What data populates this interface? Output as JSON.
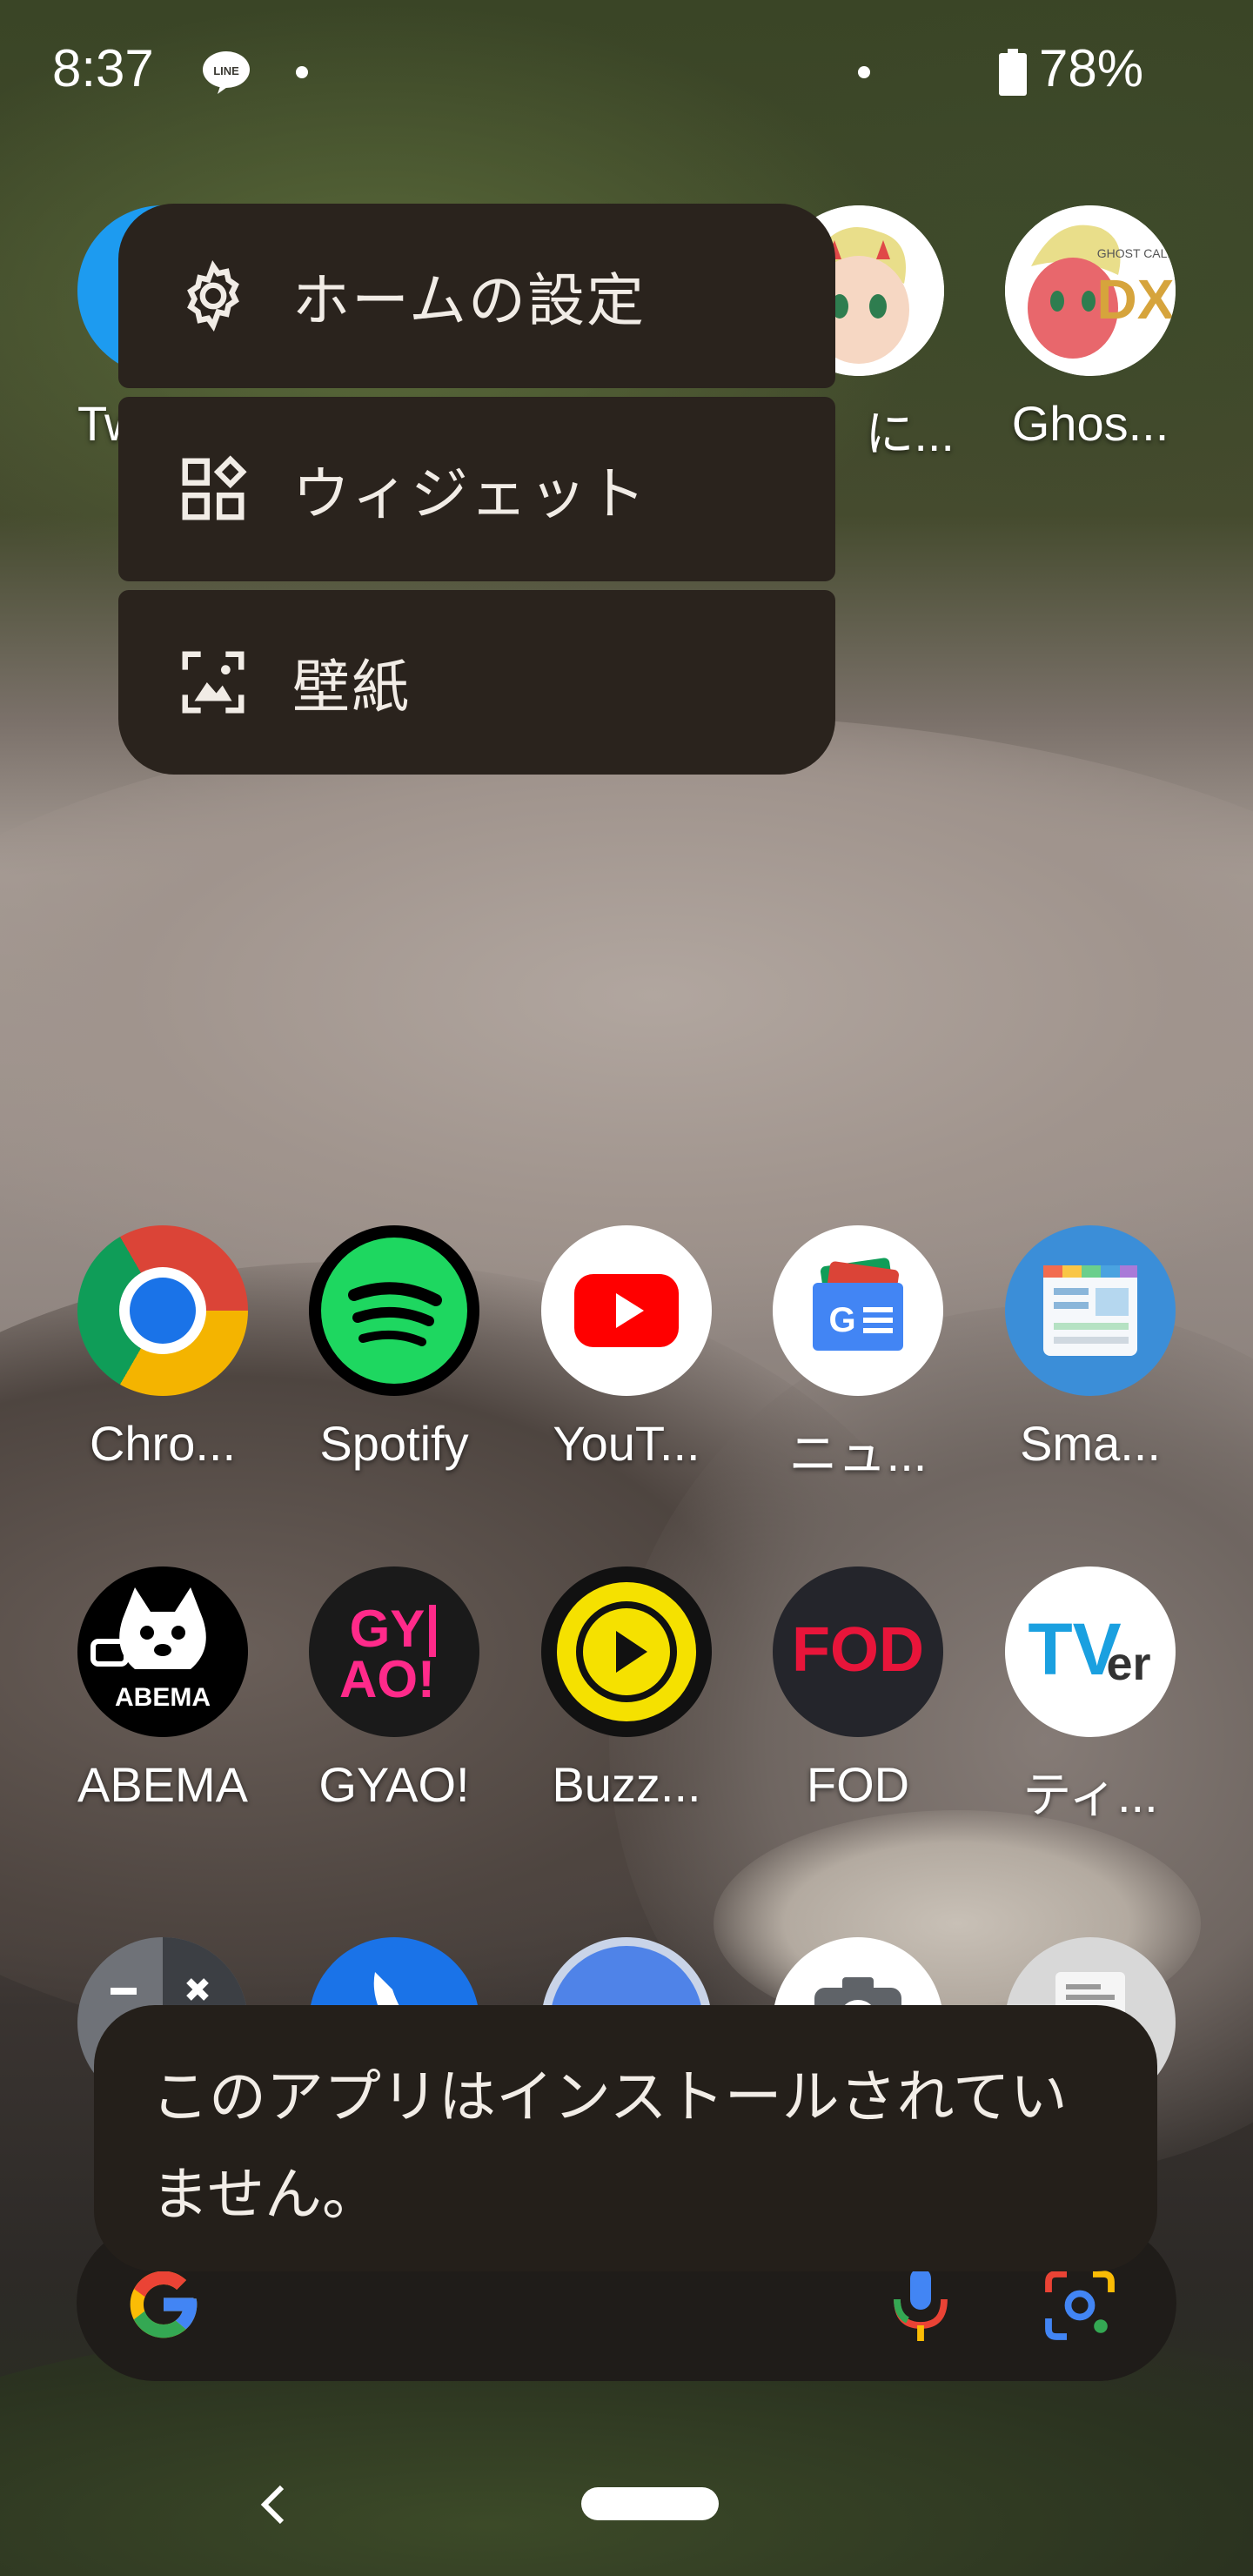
{
  "status_bar": {
    "time": "8:37",
    "notification_icon": "line-icon",
    "battery": "78%"
  },
  "context_menu": {
    "items": [
      {
        "label": "ホームの設定",
        "icon": "gear-icon"
      },
      {
        "label": "ウィジェット",
        "icon": "widgets-icon"
      },
      {
        "label": "壁紙",
        "icon": "wallpaper-icon"
      }
    ]
  },
  "top_row": {
    "apps": [
      {
        "label": "Tw",
        "icon": "twitter-icon"
      },
      {
        "label": "に...",
        "icon": "anime-character-icon"
      },
      {
        "label": "Ghos...",
        "icon": "ghost-call-dx-icon",
        "logo_text": "GHOST CALL DX"
      }
    ]
  },
  "app_grid": {
    "row1": [
      {
        "label": "Chro...",
        "icon": "chrome-icon"
      },
      {
        "label": "Spotify",
        "icon": "spotify-icon"
      },
      {
        "label": "YouT...",
        "icon": "youtube-icon"
      },
      {
        "label": "ニュ...",
        "icon": "google-news-icon"
      },
      {
        "label": "Sma...",
        "icon": "smartnews-icon"
      }
    ],
    "row2": [
      {
        "label": "ABEMA",
        "icon": "abema-icon",
        "logo_text": "ABEMA"
      },
      {
        "label": "GYAO!",
        "icon": "gyao-icon",
        "logo_text": "GY AO!"
      },
      {
        "label": "Buzz...",
        "icon": "buzzvideo-icon"
      },
      {
        "label": "FOD",
        "icon": "fod-icon",
        "logo_text": "FOD"
      },
      {
        "label": "ティ...",
        "icon": "tver-icon",
        "logo_text": "TVer"
      }
    ]
  },
  "dock": [
    {
      "icon": "calculator-icon"
    },
    {
      "icon": "phone-icon"
    },
    {
      "icon": "messages-icon"
    },
    {
      "icon": "camera-icon"
    },
    {
      "icon": "email-icon"
    }
  ],
  "toast": {
    "message": "このアプリはインストールされていません。"
  },
  "search_bar": {
    "left_icon": "google-g-icon",
    "mic_icon": "mic-icon",
    "lens_icon": "google-lens-icon"
  },
  "navigation": {
    "back_icon": "back-icon",
    "home_icon": "home-pill-icon"
  },
  "colors": {
    "menu_bg": "#2a231d",
    "toast_bg": "#241f1a",
    "search_bg": "#1f1c19"
  }
}
